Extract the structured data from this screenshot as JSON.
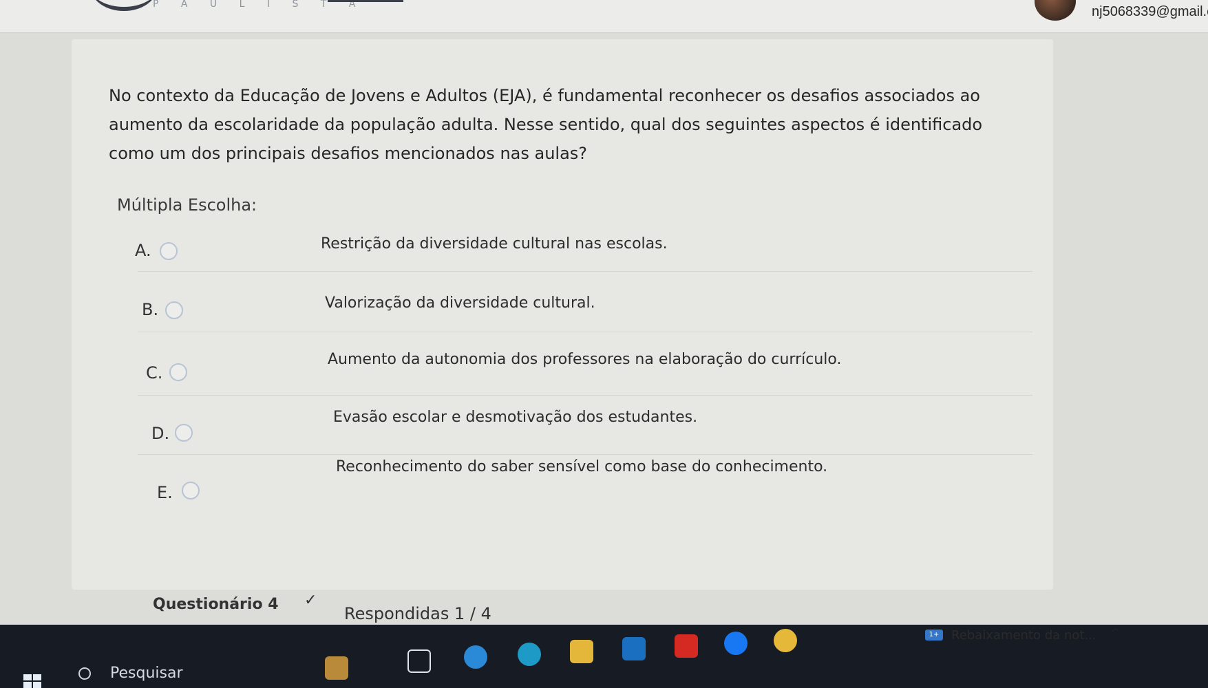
{
  "header": {
    "brand": "P A U L I S T A",
    "email": "nj5068339@gmail.c"
  },
  "quiz": {
    "question": "No contexto da Educação de Jovens e Adultos (EJA), é fundamental reconhecer os desafios associados ao aumento da escolaridade da população adulta. Nesse sentido, qual dos seguintes aspectos é identificado como um dos principais desafios mencionados nas aulas?",
    "type_label": "Múltipla Escolha:",
    "options": [
      {
        "letter": "A.",
        "text": "Restrição da diversidade cultural nas escolas."
      },
      {
        "letter": "B.",
        "text": "Valorização da diversidade cultural."
      },
      {
        "letter": "C.",
        "text": "Aumento da autonomia dos professores na elaboração do currículo."
      },
      {
        "letter": "D.",
        "text": "Evasão escolar e desmotivação dos estudantes."
      },
      {
        "letter": "E.",
        "text": "Reconhecimento do saber sensível como base do conhecimento."
      }
    ]
  },
  "footer": {
    "title": "Questionário 4",
    "check": "✓",
    "answered": "Respondidas 1 / 4"
  },
  "taskbar": {
    "search_placeholder": "Pesquisar",
    "news_badge": "1+",
    "news_text": "Rebaixamento da not...",
    "tray_icons": "^"
  }
}
